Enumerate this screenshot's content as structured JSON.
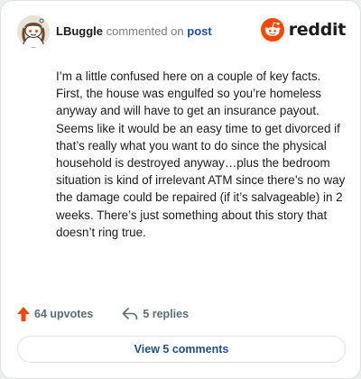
{
  "comment": {
    "username": "LBuggle",
    "verb": "commented on",
    "target": "post",
    "avatar_icon": "snoo-avatar-icon",
    "body": "I’m a little confused here on a couple of key facts. First, the house was engulfed so you’re homeless anyway and will have to get an insurance payout. Seems like it would be an easy time to get divorced if that’s really what you want to do since the physical household is destroyed anyway…plus the bedroom situation is kind of irrelevant ATM since there’s no way the damage could be repaired (if it’s salvageable) in 2 weeks. There’s just something about this story that doesn’t ring true."
  },
  "brand": {
    "name": "reddit",
    "icon": "reddit-logo-icon",
    "color": "#ff4500"
  },
  "actions": {
    "upvotes_label": "64 upvotes",
    "upvote_icon": "upvote-arrow-icon",
    "upvote_color": "#ff4500",
    "replies_label": "5 replies",
    "reply_icon": "reply-arrow-icon"
  },
  "footer": {
    "view_comments_label": "View 5 comments"
  }
}
